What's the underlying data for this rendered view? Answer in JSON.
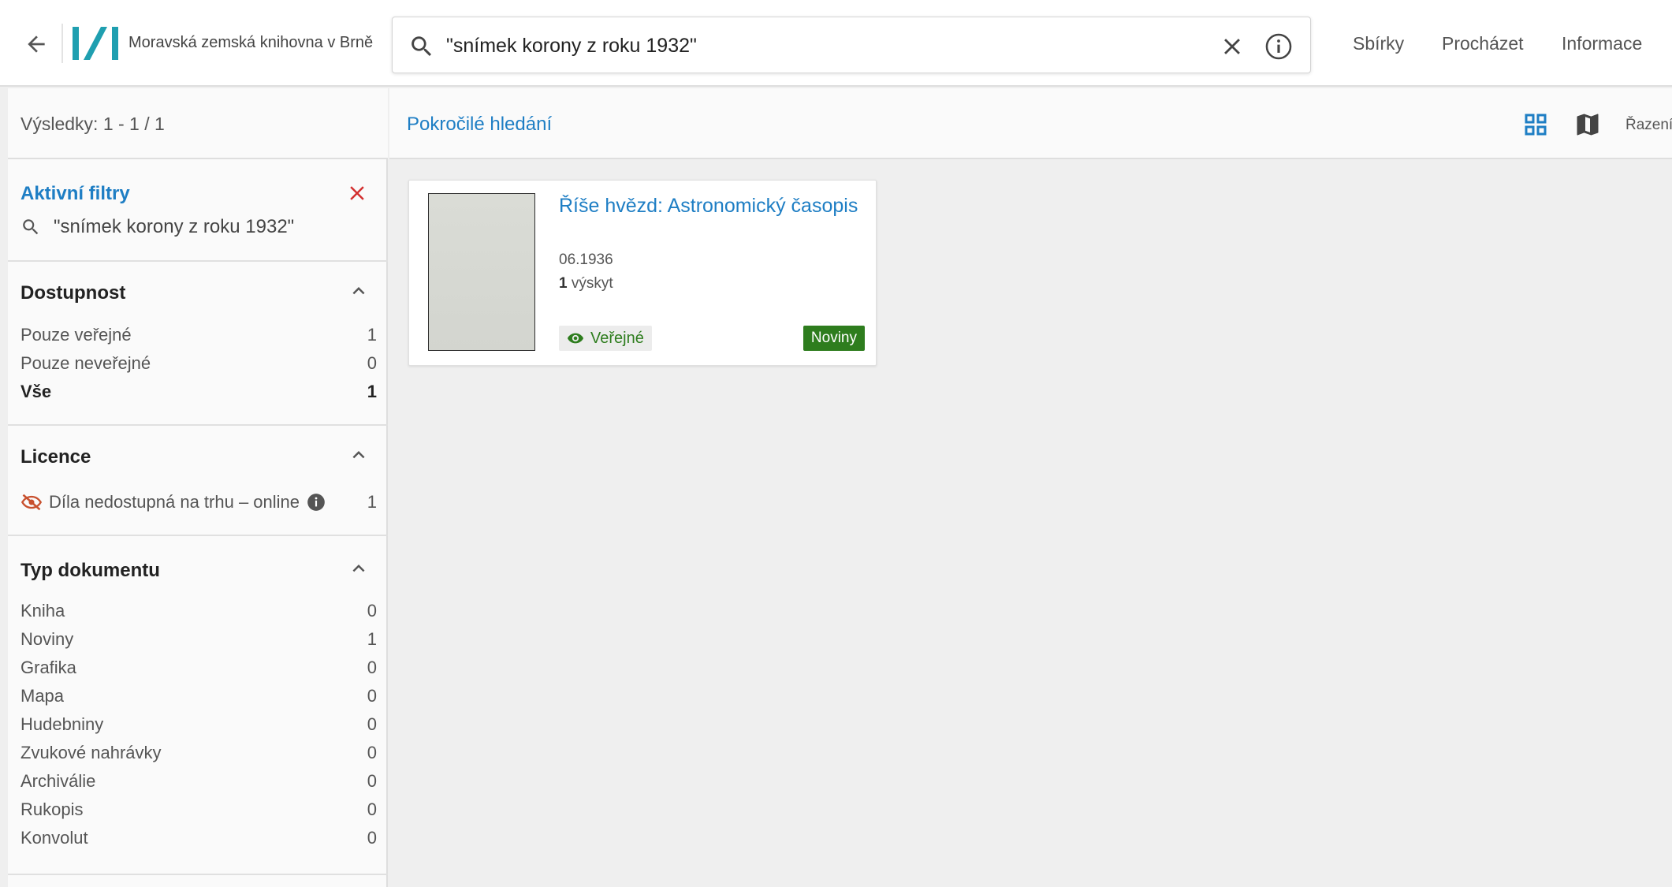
{
  "header": {
    "library_name": "Moravská zemská knihovna v Brně",
    "search": {
      "value": "\"snímek korony z roku 1932\""
    },
    "nav": [
      "Sbírky",
      "Procházet",
      "Informace"
    ]
  },
  "subheader": {
    "results": "Výsledky: 1 - 1 / 1",
    "advanced_search": "Pokročilé hledání",
    "sort_label": "Řazení"
  },
  "sidebar": {
    "active_filters": {
      "title": "Aktivní filtry",
      "query": "\"snímek korony z roku 1932\""
    },
    "availability": {
      "title": "Dostupnost",
      "items": [
        {
          "label": "Pouze veřejné",
          "count": "1"
        },
        {
          "label": "Pouze neveřejné",
          "count": "0"
        },
        {
          "label": "Vše",
          "count": "1"
        }
      ]
    },
    "licence": {
      "title": "Licence",
      "items": [
        {
          "label": "Díla nedostupná na trhu – online",
          "count": "1"
        }
      ]
    },
    "doc_type": {
      "title": "Typ dokumentu",
      "items": [
        {
          "label": "Kniha",
          "count": "0"
        },
        {
          "label": "Noviny",
          "count": "1"
        },
        {
          "label": "Grafika",
          "count": "0"
        },
        {
          "label": "Mapa",
          "count": "0"
        },
        {
          "label": "Hudebniny",
          "count": "0"
        },
        {
          "label": "Zvukové nahrávky",
          "count": "0"
        },
        {
          "label": "Archiválie",
          "count": "0"
        },
        {
          "label": "Rukopis",
          "count": "0"
        },
        {
          "label": "Konvolut",
          "count": "0"
        }
      ]
    }
  },
  "results": [
    {
      "title": "Říše hvězd: Astronomický časopis",
      "date": "06.1936",
      "occurrences_count": "1",
      "occurrences_label": "výskyt",
      "access": "Veřejné",
      "type": "Noviny"
    }
  ],
  "colors": {
    "accent": "#1e7ec4",
    "public_green": "#2e7d1e",
    "clear_red": "#d32f2f",
    "logo_teal": "#1f9fb0"
  }
}
